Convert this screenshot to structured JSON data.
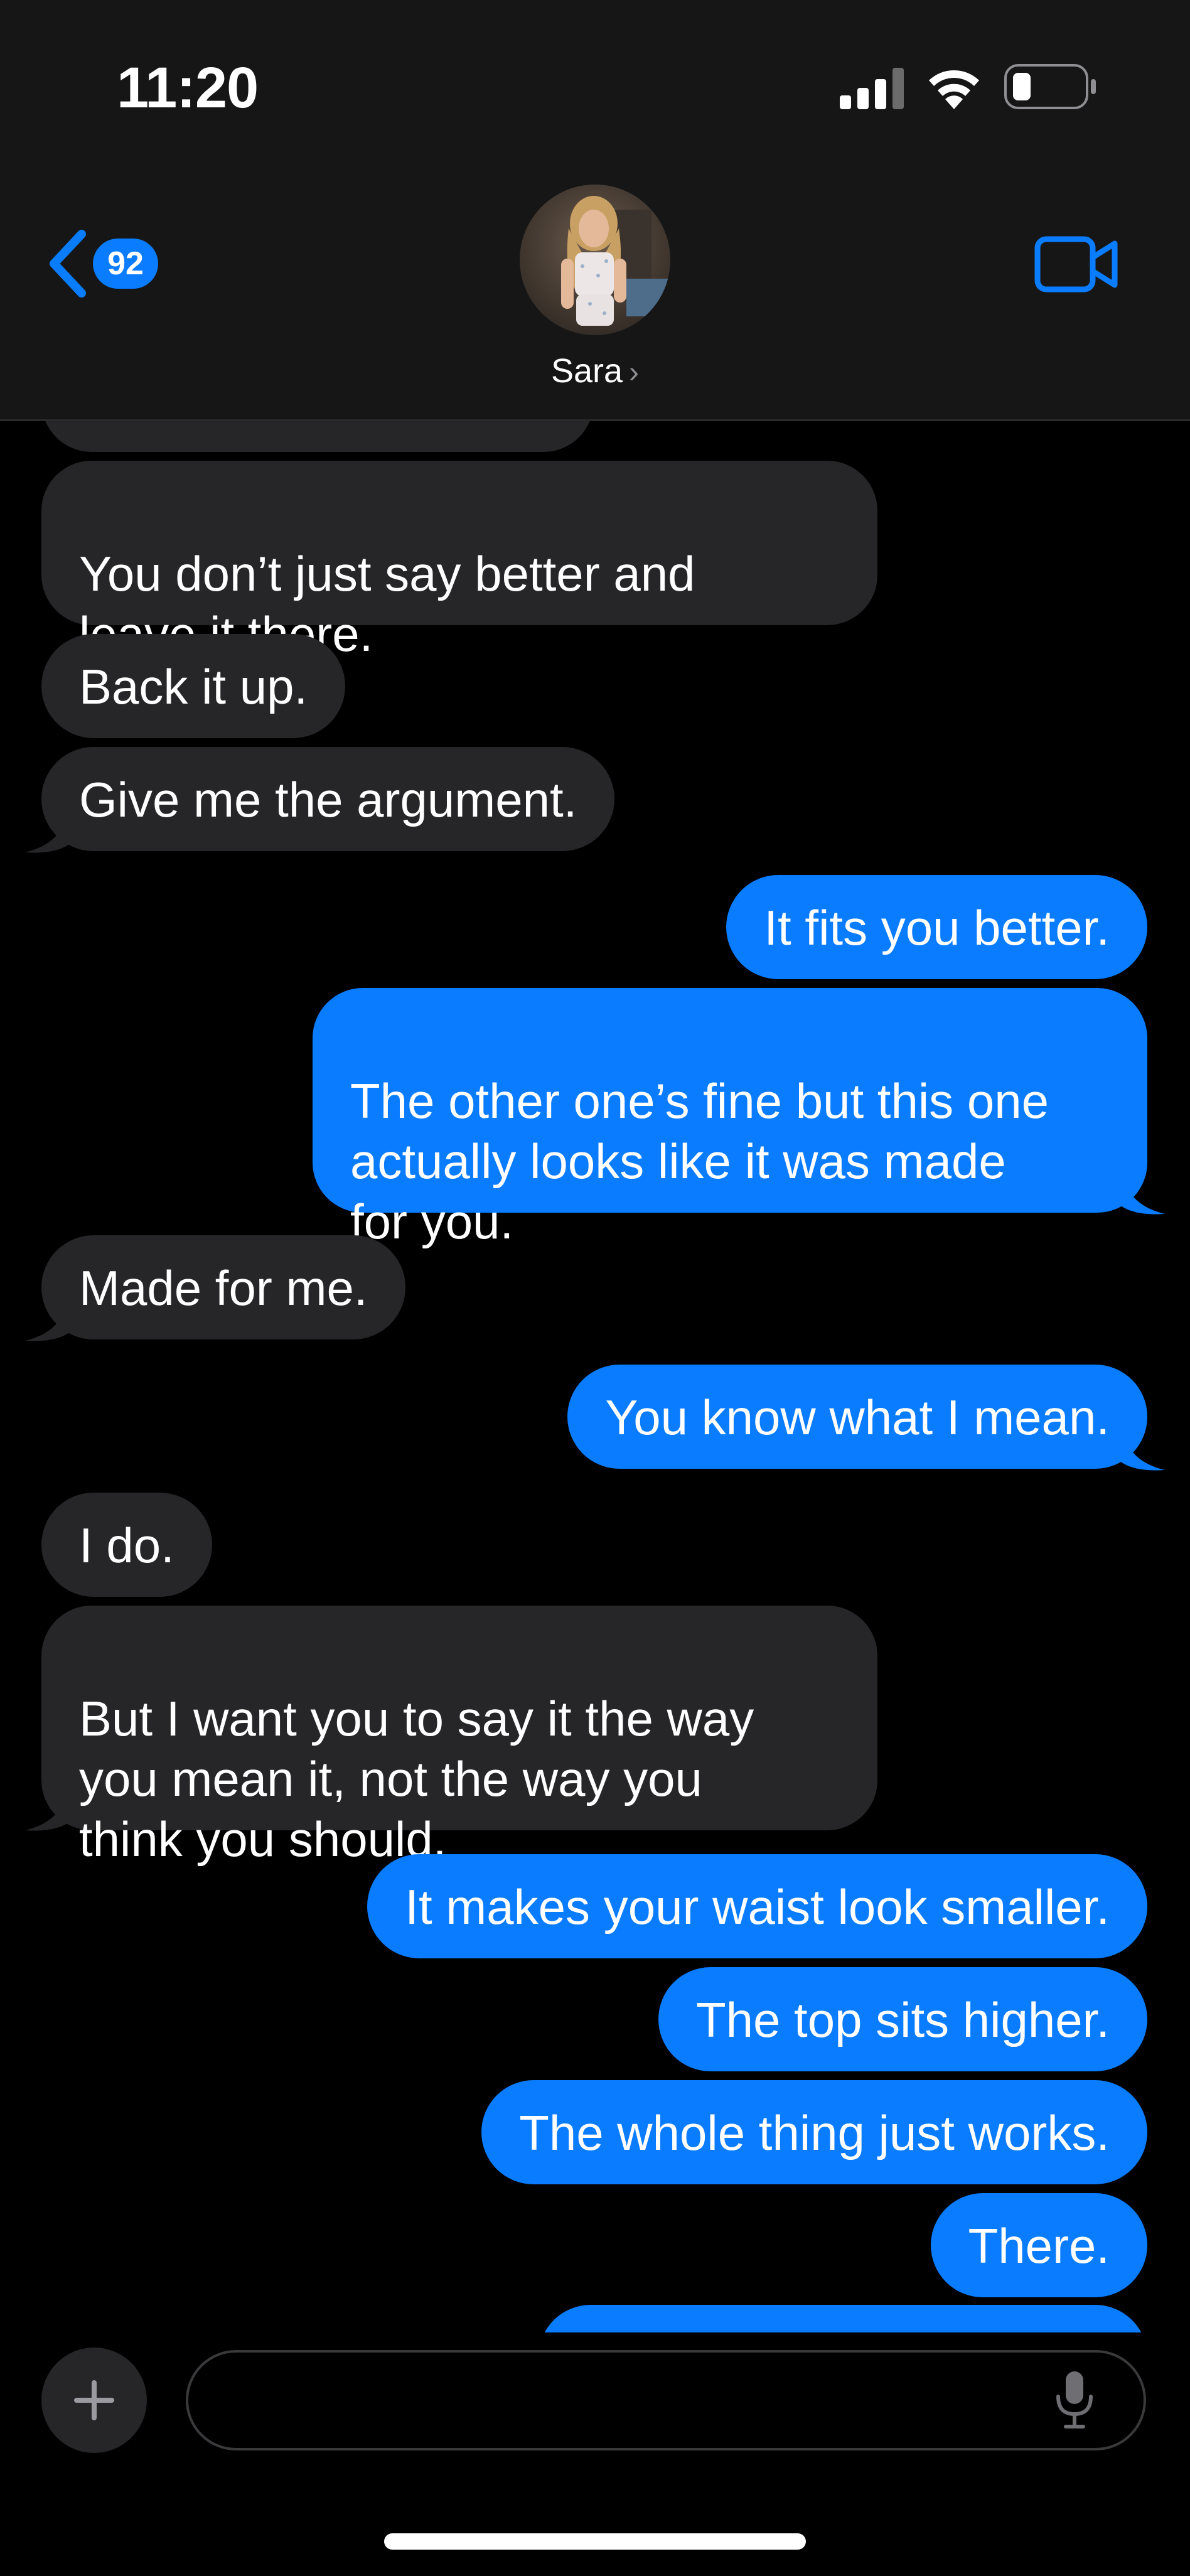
{
  "status_bar": {
    "time": "11:20",
    "battery_level": 0.2
  },
  "header": {
    "back_badge": "92",
    "contact_name": "Sara",
    "chevron": "›",
    "icons": {
      "back": "chevron-left-icon",
      "video": "video-camera-icon"
    },
    "accent_color": "#0a7cff"
  },
  "messages": [
    {
      "from": "them",
      "text": "You don’t just say better and\nleave it there."
    },
    {
      "from": "them",
      "text": "Back it up."
    },
    {
      "from": "them",
      "text": "Give me the argument."
    },
    {
      "from": "me",
      "text": "It fits you better."
    },
    {
      "from": "me",
      "text": "The other one’s fine but this one\nactually looks like it was made\nfor you."
    },
    {
      "from": "them",
      "text": "Made for me."
    },
    {
      "from": "me",
      "text": "You know what I mean."
    },
    {
      "from": "them",
      "text": "I do."
    },
    {
      "from": "them",
      "text": "But I want you to say it the way\nyou mean it, not the way you\nthink you should."
    },
    {
      "from": "me",
      "text": "It makes your waist look smaller."
    },
    {
      "from": "me",
      "text": "The top sits higher."
    },
    {
      "from": "me",
      "text": "The whole thing just works."
    },
    {
      "from": "me",
      "text": "There."
    }
  ],
  "composer": {
    "placeholder": "",
    "icons": {
      "plus": "plus-icon",
      "mic": "microphone-icon"
    }
  },
  "colors": {
    "incoming_bubble": "#262628",
    "outgoing_bubble": "#0a7cff",
    "background": "#000000"
  }
}
